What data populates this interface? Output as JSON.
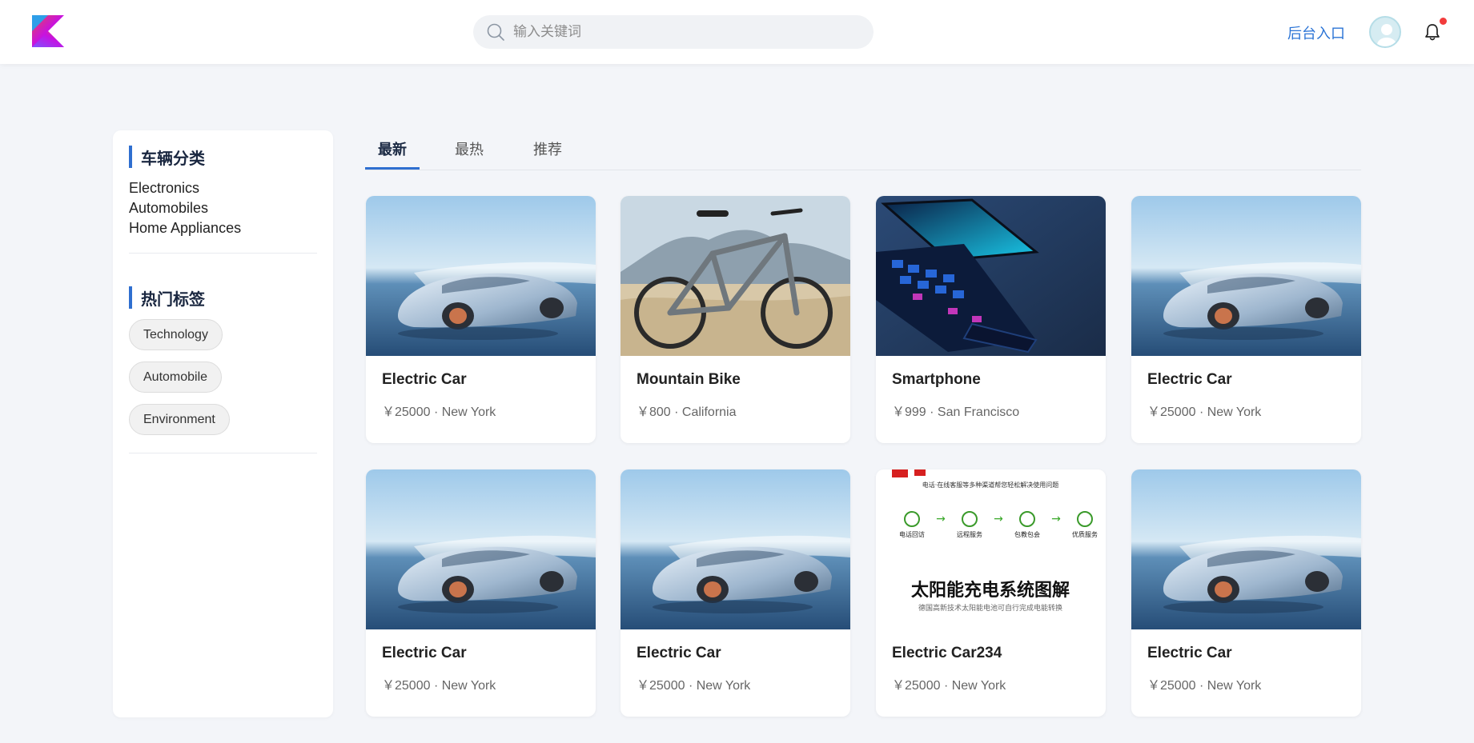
{
  "header": {
    "search_placeholder": "输入关键词",
    "admin_link": "后台入口"
  },
  "sidebar": {
    "category_title": "车辆分类",
    "categories": [
      "Electronics",
      "Automobiles",
      "Home Appliances"
    ],
    "tags_title": "热门标签",
    "tags": [
      "Technology",
      "Automobile",
      "Environment"
    ]
  },
  "tabs": [
    "最新",
    "最热",
    "推荐"
  ],
  "products": [
    {
      "title": "Electric Car",
      "meta": "￥25000 · New York",
      "image": "car"
    },
    {
      "title": "Mountain Bike",
      "meta": "￥800 · California",
      "image": "bike"
    },
    {
      "title": "Smartphone",
      "meta": "￥999 · San Francisco",
      "image": "phone"
    },
    {
      "title": "Electric Car",
      "meta": "￥25000 · New York",
      "image": "car"
    },
    {
      "title": "Electric Car",
      "meta": "￥25000 · New York",
      "image": "car"
    },
    {
      "title": "Electric Car",
      "meta": "￥25000 · New York",
      "image": "car"
    },
    {
      "title": "Electric Car234",
      "meta": "￥25000 · New York",
      "image": "solar-diagram"
    },
    {
      "title": "Electric Car",
      "meta": "￥25000 · New York",
      "image": "car"
    }
  ],
  "solar_image": {
    "subtitle": "电话·在线客服等多种渠道帮您轻松解决使用问题",
    "steps": [
      "电话回访",
      "远程服务",
      "包教包会",
      "优质服务"
    ],
    "headline": "太阳能充电系统图解",
    "caption": "德国高新技术太阳能电池可自行完成电能转换"
  },
  "colors": {
    "accent": "#2f6fd0",
    "link": "#2b74d6",
    "notification": "#f23c3c",
    "background": "#f3f5f9"
  }
}
